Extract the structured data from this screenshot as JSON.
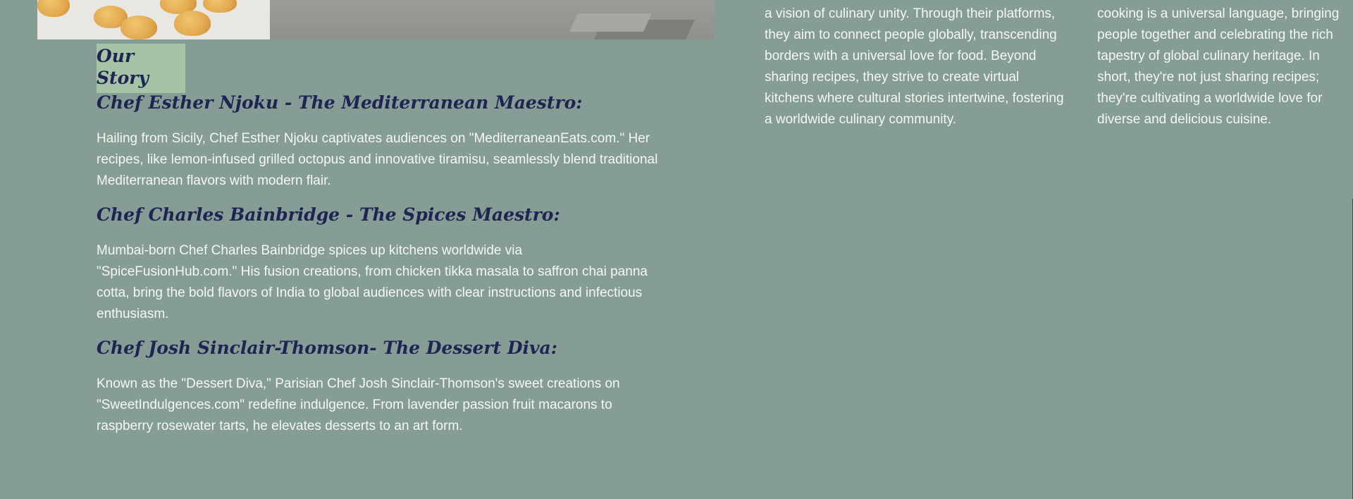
{
  "story": {
    "title_line1": "Our",
    "title_line2": "Story"
  },
  "chefs": [
    {
      "heading": "Chef Esther Njoku - The Mediterranean Maestro:",
      "text": "Hailing from Sicily, Chef Esther Njoku captivates audiences on \"MediterraneanEats.com.\" Her recipes, like lemon-infused grilled octopus and innovative tiramisu, seamlessly blend traditional Mediterranean flavors with modern flair."
    },
    {
      "heading": "Chef Charles Bainbridge - The Spices Maestro:",
      "text": "Mumbai-born Chef Charles Bainbridge spices up kitchens worldwide via \"SpiceFusionHub.com.\" His fusion creations, from chicken tikka masala to saffron chai panna cotta, bring the bold flavors of India to global audiences with clear instructions and infectious enthusiasm."
    },
    {
      "heading": "Chef Josh Sinclair-Thomson- The Dessert Diva:",
      "text": "Known as the \"Dessert Diva,\" Parisian Chef Josh Sinclair-Thomson's sweet creations on \"SweetIndulgences.com\" redefine indulgence. From lavender passion fruit macarons to raspberry rosewater tarts, he elevates desserts to an art form."
    }
  ],
  "right_columns": {
    "col1": "a vision of culinary unity. Through their platforms, they aim to connect people globally, transcending borders with a universal love for food. Beyond sharing recipes, they strive to create virtual kitchens where cultural stories intertwine, fostering a worldwide culinary community.",
    "col2": "cooking is a universal language, bringing people together and celebrating the rich tapestry of global culinary heritage. In short, they're not just sharing recipes; they're cultivating a worldwide love for diverse and delicious cuisine."
  },
  "colors": {
    "background": "#859d94",
    "heading": "#1f2452",
    "badge": "#a4c4a5",
    "body_text": "#f4f7f2"
  }
}
